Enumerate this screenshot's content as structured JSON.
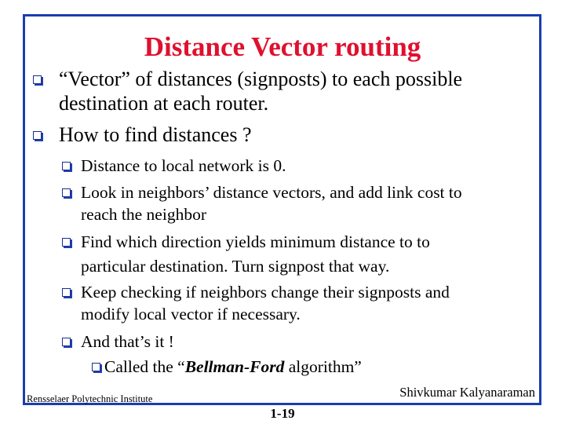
{
  "slide": {
    "title": "Distance Vector routing",
    "bullets": [
      {
        "level": 1,
        "lines": [
          "“Vector” of distances (signposts) to each possible",
          "destination at each router."
        ]
      },
      {
        "level": 1,
        "lines": [
          "How to find distances ?"
        ]
      },
      {
        "level": 2,
        "lines": [
          "Distance to local network is 0."
        ]
      },
      {
        "level": 2,
        "lines": [
          "Look in neighbors’ distance vectors, and add link cost to",
          "reach the neighbor"
        ]
      },
      {
        "level": 2,
        "lines": [
          "Find which direction yields minimum distance to to",
          "particular destination. Turn signpost that way."
        ]
      },
      {
        "level": 2,
        "lines": [
          "Keep checking if neighbors change their signposts and",
          "modify local vector if necessary."
        ]
      },
      {
        "level": 2,
        "lines": [
          "And that’s it !"
        ]
      },
      {
        "level": 3,
        "prefix": "Called the “",
        "emphasis": "Bellman-Ford",
        "suffix": " algorithm”"
      }
    ],
    "bullet_icon": "hollow-square-bullet",
    "colors": {
      "title": "#e0102f",
      "frame": "#1a3db0",
      "bullet_shadow": "#1f3fb0"
    }
  },
  "footer": {
    "institution": "Rensselaer Polytechnic Institute",
    "author": "Shivkumar Kalyanaraman",
    "page_number": "1-19"
  }
}
